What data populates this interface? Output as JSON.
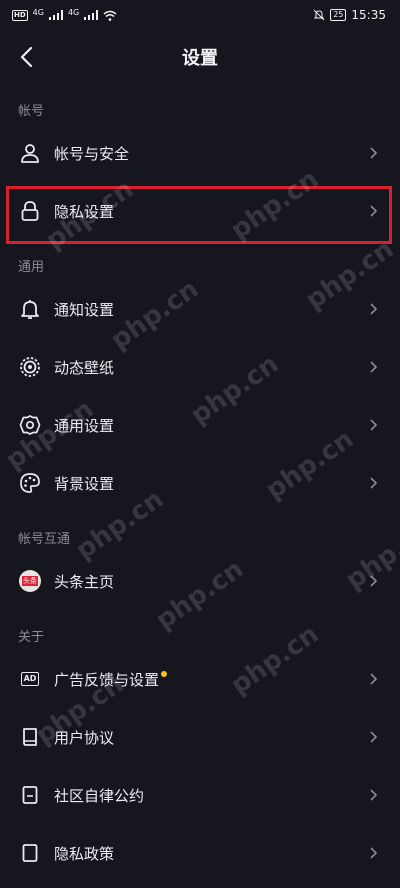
{
  "status_bar": {
    "hd_badge": "HD",
    "net1": "4G",
    "net2": "4G",
    "battery": "25",
    "time": "15:35"
  },
  "header": {
    "title": "设置"
  },
  "sections": [
    {
      "label": "帐号",
      "items": [
        {
          "label": "帐号与安全",
          "icon": "person-icon"
        },
        {
          "label": "隐私设置",
          "icon": "lock-icon",
          "highlighted": true
        }
      ]
    },
    {
      "label": "通用",
      "items": [
        {
          "label": "通知设置",
          "icon": "bell-icon"
        },
        {
          "label": "动态壁纸",
          "icon": "wallpaper-icon"
        },
        {
          "label": "通用设置",
          "icon": "gear-icon"
        },
        {
          "label": "背景设置",
          "icon": "palette-icon"
        }
      ]
    },
    {
      "label": "帐号互通",
      "items": [
        {
          "label": "头条主页",
          "icon": "toutiao-icon",
          "badge": "头条"
        }
      ]
    },
    {
      "label": "关于",
      "items": [
        {
          "label": "广告反馈与设置",
          "icon": "ad-icon",
          "badge": "AD",
          "has_dot": true
        },
        {
          "label": "用户协议",
          "icon": "book-icon"
        },
        {
          "label": "社区自律公约",
          "icon": "document-icon"
        },
        {
          "label": "隐私政策",
          "icon": "privacy-icon"
        }
      ]
    }
  ],
  "watermark": "php.cn",
  "colors": {
    "highlight": "#d8202e",
    "dot": "#f5c31c",
    "background": "#16161f"
  }
}
